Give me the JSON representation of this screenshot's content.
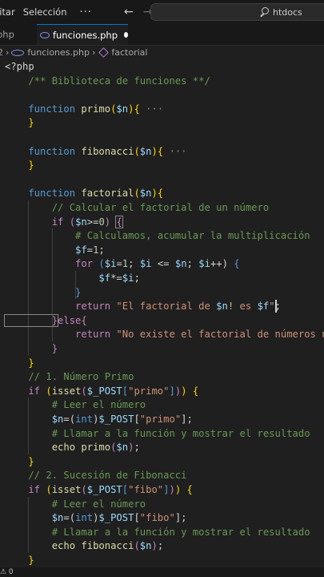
{
  "titlebar": {
    "menu_items": [
      "litar",
      "Selección"
    ],
    "more": "···",
    "back_icon": "arrow-left",
    "forward_icon": "arrow-right",
    "search_text": "htdocs"
  },
  "tabs": [
    {
      "label": "php",
      "active": false
    },
    {
      "label": "funciones.php",
      "active": true,
      "modified": true
    }
  ],
  "breadcrumb": {
    "prefix": "2",
    "file": "funciones.php",
    "symbol": "factorial"
  },
  "code_lines": [
    [
      [
        "pl",
        "<?php"
      ]
    ],
    [
      [
        "cm",
        "    /** Biblioteca de funciones **/"
      ]
    ],
    [],
    [
      [
        "kw",
        "    function "
      ],
      [
        "fn",
        "primo"
      ],
      [
        "y",
        "("
      ],
      [
        "var",
        "$n"
      ],
      [
        "y",
        "){"
      ],
      [
        "fold",
        " ···"
      ]
    ],
    [
      [
        "y",
        "    }"
      ]
    ],
    [],
    [
      [
        "kw",
        "    function "
      ],
      [
        "fn",
        "fibonacci"
      ],
      [
        "y",
        "("
      ],
      [
        "var",
        "$n"
      ],
      [
        "y",
        "){"
      ],
      [
        "fold",
        " ···"
      ]
    ],
    [
      [
        "y",
        "    }"
      ]
    ],
    [],
    [
      [
        "kw",
        "    function "
      ],
      [
        "fn",
        "factorial"
      ],
      [
        "y",
        "("
      ],
      [
        "var",
        "$n"
      ],
      [
        "y",
        "){"
      ]
    ],
    [
      [
        "cm",
        "        // Calcular el factorial de un número"
      ]
    ],
    [
      [
        "ctl",
        "        if "
      ],
      [
        "ctl",
        "("
      ],
      [
        "var",
        "$n"
      ],
      [
        "pl",
        ">="
      ],
      [
        "num",
        "0"
      ],
      [
        "ctl",
        ") "
      ],
      [
        "ctl",
        "{"
      ]
    ],
    [
      [
        "cm",
        "            # Calculamos, acumular la multiplicación"
      ]
    ],
    [
      [
        "var",
        "            $f"
      ],
      [
        "pl",
        "="
      ],
      [
        "num",
        "1"
      ],
      [
        "pl",
        ";"
      ]
    ],
    [
      [
        "ctl",
        "            for "
      ],
      [
        "kw",
        "("
      ],
      [
        "var",
        "$i"
      ],
      [
        "pl",
        "="
      ],
      [
        "num",
        "1"
      ],
      [
        "pl",
        "; "
      ],
      [
        "var",
        "$i"
      ],
      [
        "pl",
        " <= "
      ],
      [
        "var",
        "$n"
      ],
      [
        "pl",
        "; "
      ],
      [
        "var",
        "$i"
      ],
      [
        "pl",
        "++) "
      ],
      [
        "kw",
        "{"
      ]
    ],
    [
      [
        "var",
        "                $f"
      ],
      [
        "pl",
        "*="
      ],
      [
        "var",
        "$i"
      ],
      [
        "pl",
        ";"
      ]
    ],
    [
      [
        "kw",
        "            }"
      ]
    ],
    [
      [
        "ctl",
        "            return "
      ],
      [
        "str",
        "\"El factorial de "
      ],
      [
        "var",
        "$n"
      ],
      [
        "esc",
        "!"
      ],
      [
        "str",
        " es "
      ],
      [
        "var",
        "$f"
      ],
      [
        "str",
        "\""
      ],
      [
        "pl",
        ";"
      ]
    ],
    [
      [
        "ctl",
        "        }"
      ],
      [
        "ctl",
        "else"
      ],
      [
        "ctl",
        "{"
      ]
    ],
    [
      [
        "ctl",
        "            return "
      ],
      [
        "str",
        "\"No existe el factorial de números neg"
      ]
    ],
    [
      [
        "ctl",
        "        }"
      ]
    ],
    [
      [
        "y",
        "    }"
      ]
    ],
    [
      [
        "cm",
        "    // 1. Número Primo"
      ]
    ],
    [
      [
        "ctl",
        "    if "
      ],
      [
        "y",
        "("
      ],
      [
        "fn",
        "isset"
      ],
      [
        "ctl",
        "("
      ],
      [
        "var",
        "$_POST"
      ],
      [
        "kw",
        "["
      ],
      [
        "str",
        "\"primo\""
      ],
      [
        "kw",
        "]"
      ],
      [
        "ctl",
        ")"
      ],
      [
        "y",
        ")"
      ],
      [
        "pl",
        " "
      ],
      [
        "y",
        "{"
      ]
    ],
    [
      [
        "cm",
        "        # Leer el número"
      ]
    ],
    [
      [
        "var",
        "        $n"
      ],
      [
        "pl",
        "=("
      ],
      [
        "kw",
        "int"
      ],
      [
        "pl",
        ")"
      ],
      [
        "var",
        "$_POST"
      ],
      [
        "pl",
        "["
      ],
      [
        "str",
        "\"primo\""
      ],
      [
        "pl",
        "];"
      ]
    ],
    [
      [
        "cm",
        "        # Llamar a la función y mostrar el resultado"
      ]
    ],
    [
      [
        "fn",
        "        echo "
      ],
      [
        "fn",
        "primo"
      ],
      [
        "ctl",
        "("
      ],
      [
        "var",
        "$n"
      ],
      [
        "ctl",
        ")"
      ],
      [
        "pl",
        ";"
      ]
    ],
    [
      [
        "y",
        "    }"
      ]
    ],
    [
      [
        "cm",
        "    // 2. Sucesión de Fibonacci"
      ]
    ],
    [
      [
        "ctl",
        "    if "
      ],
      [
        "y",
        "("
      ],
      [
        "fn",
        "isset"
      ],
      [
        "ctl",
        "("
      ],
      [
        "var",
        "$_POST"
      ],
      [
        "kw",
        "["
      ],
      [
        "str",
        "\"fibo\""
      ],
      [
        "kw",
        "]"
      ],
      [
        "ctl",
        ")"
      ],
      [
        "y",
        ")"
      ],
      [
        "pl",
        " "
      ],
      [
        "y",
        "{"
      ]
    ],
    [
      [
        "cm",
        "        # Leer el número"
      ]
    ],
    [
      [
        "var",
        "        $n"
      ],
      [
        "pl",
        "=("
      ],
      [
        "kw",
        "int"
      ],
      [
        "pl",
        ")"
      ],
      [
        "var",
        "$_POST"
      ],
      [
        "pl",
        "["
      ],
      [
        "str",
        "\"fibo\""
      ],
      [
        "pl",
        "];"
      ]
    ],
    [
      [
        "cm",
        "        # Llamar a la función y mostrar el resultado"
      ]
    ],
    [
      [
        "fn",
        "        echo "
      ],
      [
        "fn",
        "fibonacci"
      ],
      [
        "ctl",
        "("
      ],
      [
        "var",
        "$n"
      ],
      [
        "ctl",
        ")"
      ],
      [
        "pl",
        ";"
      ]
    ],
    [
      [
        "y",
        "    }"
      ]
    ]
  ],
  "statusbar": {
    "problems": "⚠ 0"
  },
  "colors": {
    "background": "#1f1f1f",
    "keyword": "#569cd6",
    "function": "#dcdcaa",
    "variable": "#9cdcfe",
    "string": "#ce9178",
    "comment": "#6a9955",
    "control": "#c586c0"
  }
}
